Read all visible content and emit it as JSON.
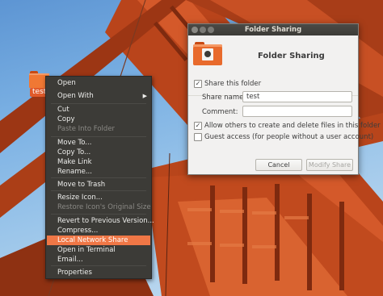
{
  "desktop": {
    "folder_name": "test"
  },
  "context_menu": {
    "items": [
      {
        "label": "Open",
        "state": "normal"
      },
      {
        "label": "Open With",
        "state": "submenu"
      },
      {
        "label": "Cut",
        "state": "normal"
      },
      {
        "label": "Copy",
        "state": "normal"
      },
      {
        "label": "Paste Into Folder",
        "state": "disabled"
      },
      {
        "label": "Move To...",
        "state": "normal"
      },
      {
        "label": "Copy To...",
        "state": "normal"
      },
      {
        "label": "Make Link",
        "state": "normal"
      },
      {
        "label": "Rename...",
        "state": "normal"
      },
      {
        "label": "Move to Trash",
        "state": "normal"
      },
      {
        "label": "Resize Icon...",
        "state": "normal"
      },
      {
        "label": "Restore Icon's Original Size",
        "state": "disabled"
      },
      {
        "label": "Revert to Previous Version...",
        "state": "normal"
      },
      {
        "label": "Compress...",
        "state": "normal"
      },
      {
        "label": "Local Network Share",
        "state": "highlighted"
      },
      {
        "label": "Open in Terminal",
        "state": "normal"
      },
      {
        "label": "Email...",
        "state": "normal"
      },
      {
        "label": "Properties",
        "state": "normal"
      }
    ]
  },
  "dialog": {
    "window_title": "Folder Sharing",
    "heading": "Folder Sharing",
    "share_this_folder": {
      "label": "Share this folder",
      "checked": true
    },
    "share_name": {
      "label": "Share name:",
      "value": "test"
    },
    "comment": {
      "label": "Comment:",
      "value": ""
    },
    "allow_others": {
      "label": "Allow others to create and delete files in this folder",
      "checked": true
    },
    "guest_access": {
      "label": "Guest access (for people without a user account)",
      "checked": false
    },
    "cancel_label": "Cancel",
    "modify_label": "Modify Share"
  },
  "colors": {
    "menu_bg": "#3c3b37",
    "highlight": "#f07746",
    "bridge": "#c2481d",
    "folder": "#f07834"
  }
}
